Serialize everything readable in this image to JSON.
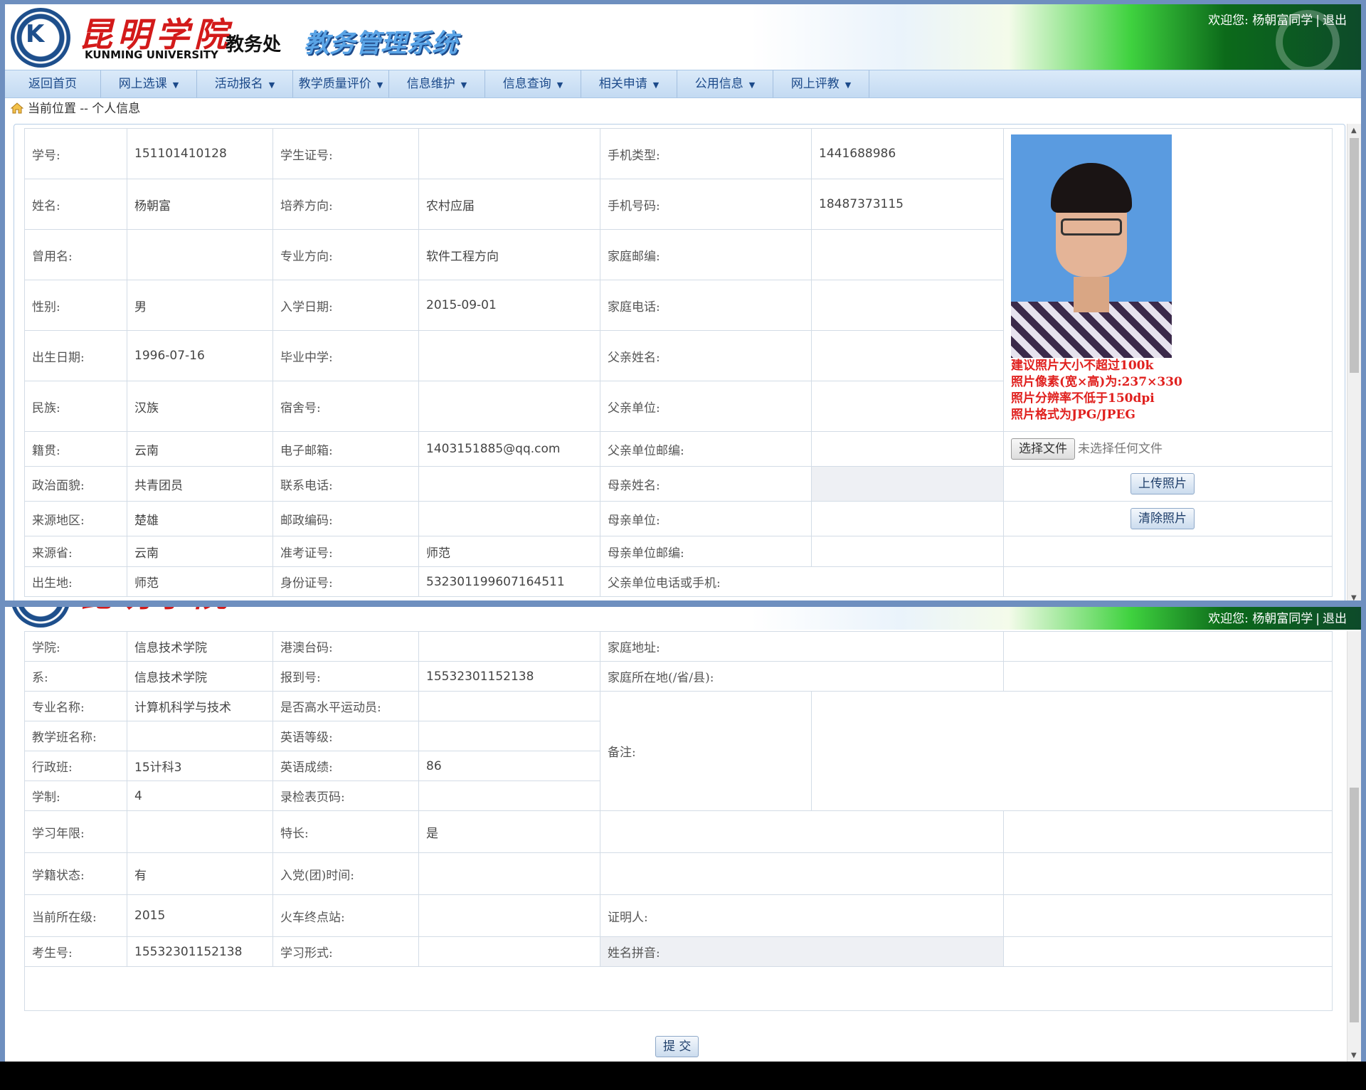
{
  "header": {
    "logo_circle_text": "K",
    "logo_cn": "昆明学院",
    "logo_en": "KUNMING UNIVERSITY",
    "dept": "教务处",
    "system_name": "教务管理系统",
    "welcome": "欢迎您:",
    "user": "杨朝富同学",
    "separator": "|",
    "logout": "退出"
  },
  "nav": [
    "返回首页",
    "网上选课",
    "活动报名",
    "教学质量评价",
    "信息维护",
    "信息查询",
    "相关申请",
    "公用信息",
    "网上评教"
  ],
  "breadcrumb": "当前位置 -- 个人信息",
  "photo_hints": [
    "建议照片大小不超过100k",
    "照片像素(宽×高)为:237×330",
    "照片分辨率不低于150dpi",
    "照片格式为JPG/JPEG"
  ],
  "file": {
    "choose": "选择文件",
    "status": "未选择任何文件"
  },
  "buttons": {
    "upload": "上传照片",
    "clear": "清除照片",
    "submit": "提 交"
  },
  "rows1": [
    [
      "学号:",
      "151101410128",
      "学生证号:",
      "",
      "手机类型:",
      "1441688986"
    ],
    [
      "姓名:",
      "杨朝富",
      "培养方向:",
      "农村应届",
      "手机号码:",
      "18487373115"
    ],
    [
      "曾用名:",
      "",
      "专业方向:",
      "软件工程方向",
      "家庭邮编:",
      ""
    ],
    [
      "性别:",
      "男",
      "入学日期:",
      "2015-09-01",
      "家庭电话:",
      ""
    ],
    [
      "出生日期:",
      "1996-07-16",
      "毕业中学:",
      "",
      "父亲姓名:",
      ""
    ],
    [
      "民族:",
      "汉族",
      "宿舍号:",
      "",
      "父亲单位:",
      ""
    ],
    [
      "籍贯:",
      "云南",
      "电子邮箱:",
      "1403151885@qq.com",
      "父亲单位邮编:",
      ""
    ],
    [
      "政治面貌:",
      "共青团员",
      "联系电话:",
      "",
      "母亲姓名:",
      ""
    ],
    [
      "来源地区:",
      "楚雄",
      "邮政编码:",
      "",
      "母亲单位:",
      ""
    ],
    [
      "来源省:",
      "云南",
      "准考证号:",
      "师范",
      "母亲单位邮编:",
      ""
    ],
    [
      "出生地:",
      "师范",
      "身份证号:",
      "532301199607164511",
      "父亲单位电话或手机:",
      ""
    ]
  ],
  "rows2": [
    [
      "学院:",
      "信息技术学院",
      "港澳台码:",
      "",
      "家庭地址:",
      "",
      ""
    ],
    [
      "系:",
      "信息技术学院",
      "报到号:",
      "15532301152138",
      "家庭所在地(/省/县):",
      "",
      ""
    ],
    [
      "专业名称:",
      "计算机科学与技术",
      "是否高水平运动员:",
      ""
    ],
    [
      "教学班名称:",
      "",
      "英语等级:",
      ""
    ],
    [
      "行政班:",
      "15计科3",
      "英语成绩:",
      "86"
    ],
    [
      "学制:",
      "4",
      "录检表页码:",
      ""
    ],
    [
      "学习年限:",
      "",
      "特长:",
      "是",
      "",
      "",
      ""
    ],
    [
      "学籍状态:",
      "有",
      "入党(团)时间:",
      "",
      "",
      "",
      ""
    ],
    [
      "当前所在级:",
      "2015",
      "火车终点站:",
      "",
      "证明人:",
      "",
      ""
    ],
    [
      "考生号:",
      "15532301152138",
      "学习形式:",
      "",
      "姓名拼音:",
      "",
      ""
    ]
  ],
  "remarks_label": "备注:"
}
